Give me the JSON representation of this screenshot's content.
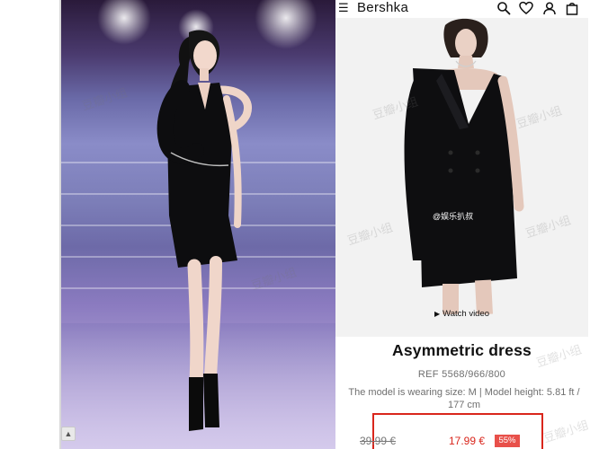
{
  "header": {
    "menu_glyph": "☰",
    "brand": "Bershka",
    "icons": [
      "search-icon",
      "heart-icon",
      "user-icon",
      "bag-icon"
    ]
  },
  "product": {
    "watch_label": "Watch video",
    "title": "Asymmetric dress",
    "ref": "REF 5568/966/800",
    "model_info": "The model is wearing size: M | Model height: 5.81 ft / 177 cm",
    "old_price": "39.99 €",
    "new_price": "17.99 €",
    "discount": "55%"
  },
  "overlays": {
    "watermark": "豆瓣小组",
    "weibo_tag": "@娱乐扒叔"
  },
  "colors": {
    "sale_red": "#d9261c",
    "discount_bg": "#e8504a",
    "text_dark": "#111111",
    "text_grey": "#6f6f6f"
  }
}
